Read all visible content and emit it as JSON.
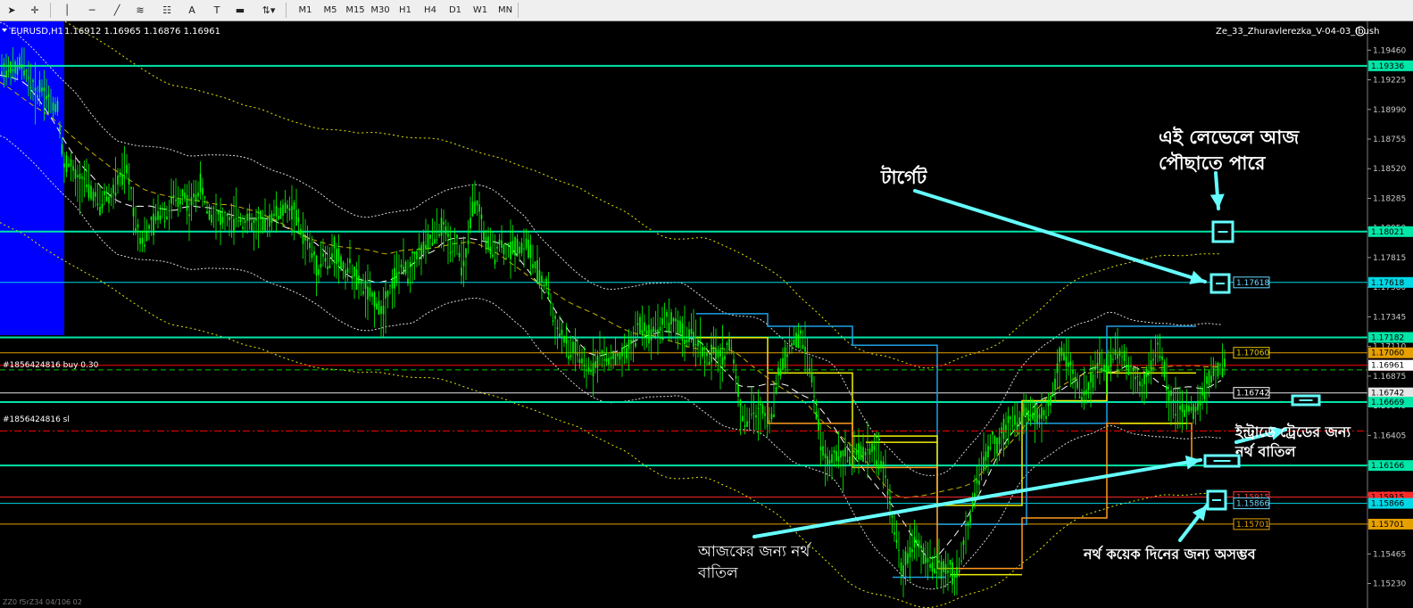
{
  "toolbar": {
    "tools": [
      {
        "name": "cursor-icon",
        "glyph": "➤"
      },
      {
        "name": "crosshair-icon",
        "glyph": "✛"
      },
      {
        "name": "vertical-line-icon",
        "glyph": "│"
      },
      {
        "name": "horizontal-line-icon",
        "glyph": "─"
      },
      {
        "name": "trendline-icon",
        "glyph": "╱"
      },
      {
        "name": "fibonacci-fan-icon",
        "glyph": "≋"
      },
      {
        "name": "fibonacci-retracement-icon",
        "glyph": "☷"
      },
      {
        "name": "text-icon",
        "glyph": "A"
      },
      {
        "name": "text-label-icon",
        "glyph": "T"
      },
      {
        "name": "rectangle-icon",
        "glyph": "▬"
      },
      {
        "name": "shapes-dropdown-icon",
        "glyph": "⇅▾"
      }
    ],
    "timeframes": [
      "M1",
      "M5",
      "M15",
      "M30",
      "H1",
      "H4",
      "D1",
      "W1",
      "MN"
    ]
  },
  "chart_header": {
    "symbol": "EURUSD,H1",
    "ohlc": "1.16912 1.16965 1.16876 1.16961",
    "indicator": "Ze_33_Zhuravlerezka_V-04-03_Ibush"
  },
  "chart_data": {
    "type": "line",
    "symbol": "EURUSD,H1",
    "ylim": [
      1.1505,
      1.1966
    ],
    "y_ticks": [
      1.1946,
      1.19225,
      1.1899,
      1.18755,
      1.1852,
      1.18285,
      1.1805,
      1.17815,
      1.1758,
      1.17345,
      1.1711,
      1.16875,
      1.1664,
      1.16405,
      1.1617,
      1.15935,
      1.157,
      1.15465,
      1.1523
    ],
    "horizontal_levels": [
      {
        "value": 1.19336,
        "label": "1.19336",
        "color": "#00e6a8",
        "width": 2
      },
      {
        "value": 1.18021,
        "label": "1.18021",
        "color": "#00e6a8",
        "width": 2
      },
      {
        "value": 1.17618,
        "label": "1.17618",
        "color": "#00d8e6",
        "width": 1
      },
      {
        "value": 1.17182,
        "label": "1.17182",
        "color": "#00e6a8",
        "width": 2
      },
      {
        "value": 1.1706,
        "label": "1.17060",
        "color": "#e6a000",
        "width": 1
      },
      {
        "value": 1.16961,
        "label": "1.16961",
        "color": "#ff0000",
        "width": 1
      },
      {
        "value": 1.16742,
        "label": "1.16742",
        "color": "#e6e6e6",
        "width": 1
      },
      {
        "value": 1.16669,
        "label": "1.16669",
        "color": "#00e6a8",
        "width": 2
      },
      {
        "value": 1.16166,
        "label": "1.16166",
        "color": "#00e6a8",
        "width": 2
      },
      {
        "value": 1.15915,
        "label": "1.15915",
        "color": "#ff2a2a",
        "width": 1
      },
      {
        "value": 1.15866,
        "label": "1.15866",
        "color": "#00d8e6",
        "width": 1
      },
      {
        "value": 1.15701,
        "label": "1.15701",
        "color": "#e6a000",
        "width": 1
      }
    ],
    "order_lines": [
      {
        "value": 1.16925,
        "label": "#1856424816 buy 0.30",
        "color": "#00c800"
      },
      {
        "value": 1.1644,
        "label": "#1856424816 sl",
        "color": "#ff0000"
      }
    ],
    "current_price": 1.16961,
    "price_path": [
      [
        0,
        1.1925
      ],
      [
        4,
        1.1935
      ],
      [
        8,
        1.1928
      ],
      [
        12,
        1.1932
      ],
      [
        18,
        1.1928
      ],
      [
        22,
        1.1935
      ],
      [
        28,
        1.193
      ],
      [
        34,
        1.1922
      ],
      [
        40,
        1.191
      ],
      [
        46,
        1.1918
      ],
      [
        52,
        1.1912
      ],
      [
        58,
        1.19
      ],
      [
        64,
        1.1905
      ],
      [
        68,
        1.188
      ],
      [
        72,
        1.185
      ],
      [
        76,
        1.186
      ],
      [
        82,
        1.1848
      ],
      [
        88,
        1.184
      ],
      [
        94,
        1.1845
      ],
      [
        100,
        1.1835
      ],
      [
        106,
        1.183
      ],
      [
        112,
        1.1822
      ],
      [
        118,
        1.1832
      ],
      [
        124,
        1.1828
      ],
      [
        130,
        1.184
      ],
      [
        136,
        1.1845
      ],
      [
        142,
        1.185
      ],
      [
        148,
        1.183
      ],
      [
        152,
        1.181
      ],
      [
        158,
        1.1795
      ],
      [
        164,
        1.18
      ],
      [
        170,
        1.1805
      ],
      [
        176,
        1.1815
      ],
      [
        182,
        1.182
      ],
      [
        188,
        1.1815
      ],
      [
        194,
        1.183
      ],
      [
        200,
        1.1825
      ],
      [
        206,
        1.1835
      ],
      [
        212,
        1.182
      ],
      [
        218,
        1.183
      ],
      [
        224,
        1.184
      ],
      [
        230,
        1.1825
      ],
      [
        236,
        1.1815
      ],
      [
        242,
        1.182
      ],
      [
        248,
        1.181
      ],
      [
        254,
        1.1812
      ],
      [
        260,
        1.1808
      ],
      [
        266,
        1.1815
      ],
      [
        272,
        1.181
      ],
      [
        278,
        1.1812
      ],
      [
        284,
        1.1805
      ],
      [
        290,
        1.181
      ],
      [
        296,
        1.1807
      ],
      [
        302,
        1.1812
      ],
      [
        308,
        1.1818
      ],
      [
        314,
        1.1815
      ],
      [
        320,
        1.1822
      ],
      [
        326,
        1.182
      ],
      [
        332,
        1.1815
      ],
      [
        338,
        1.18
      ],
      [
        344,
        1.1795
      ],
      [
        350,
        1.1785
      ],
      [
        356,
        1.177
      ],
      [
        362,
        1.1785
      ],
      [
        368,
        1.1775
      ],
      [
        374,
        1.179
      ],
      [
        380,
        1.178
      ],
      [
        386,
        1.177
      ],
      [
        392,
        1.1775
      ],
      [
        398,
        1.1765
      ],
      [
        404,
        1.176
      ],
      [
        410,
        1.1755
      ],
      [
        416,
        1.175
      ],
      [
        422,
        1.1745
      ],
      [
        428,
        1.1738
      ],
      [
        434,
        1.1752
      ],
      [
        440,
        1.1762
      ],
      [
        446,
        1.177
      ],
      [
        452,
        1.1775
      ],
      [
        458,
        1.177
      ],
      [
        464,
        1.178
      ],
      [
        470,
        1.1785
      ],
      [
        476,
        1.179
      ],
      [
        482,
        1.1795
      ],
      [
        488,
        1.18
      ],
      [
        494,
        1.1805
      ],
      [
        500,
        1.18
      ],
      [
        506,
        1.179
      ],
      [
        512,
        1.1795
      ],
      [
        518,
        1.177
      ],
      [
        524,
        1.179
      ],
      [
        530,
        1.1825
      ],
      [
        536,
        1.182
      ],
      [
        542,
        1.18
      ],
      [
        548,
        1.179
      ],
      [
        554,
        1.1785
      ],
      [
        560,
        1.1795
      ],
      [
        566,
        1.1785
      ],
      [
        572,
        1.179
      ],
      [
        578,
        1.1792
      ],
      [
        584,
        1.1788
      ],
      [
        590,
        1.1795
      ],
      [
        596,
        1.178
      ],
      [
        602,
        1.177
      ],
      [
        608,
        1.176
      ],
      [
        614,
        1.176
      ],
      [
        620,
        1.173
      ],
      [
        626,
        1.1725
      ],
      [
        632,
        1.1715
      ],
      [
        638,
        1.1705
      ],
      [
        644,
        1.171
      ],
      [
        650,
        1.17
      ],
      [
        656,
        1.169
      ],
      [
        662,
        1.1695
      ],
      [
        668,
        1.17
      ],
      [
        674,
        1.1705
      ],
      [
        680,
        1.1698
      ],
      [
        686,
        1.1705
      ],
      [
        692,
        1.17
      ],
      [
        698,
        1.1702
      ],
      [
        704,
        1.171
      ],
      [
        710,
        1.1715
      ],
      [
        716,
        1.173
      ],
      [
        722,
        1.1725
      ],
      [
        728,
        1.172
      ],
      [
        734,
        1.173
      ],
      [
        740,
        1.1725
      ],
      [
        746,
        1.1735
      ],
      [
        752,
        1.173
      ],
      [
        758,
        1.1728
      ],
      [
        764,
        1.1722
      ],
      [
        770,
        1.172
      ],
      [
        776,
        1.1718
      ],
      [
        782,
        1.1715
      ],
      [
        788,
        1.1705
      ],
      [
        794,
        1.17
      ],
      [
        800,
        1.171
      ],
      [
        806,
        1.17
      ],
      [
        812,
        1.1705
      ],
      [
        818,
        1.1715
      ],
      [
        824,
        1.169
      ],
      [
        830,
        1.166
      ],
      [
        836,
        1.165
      ],
      [
        842,
        1.166
      ],
      [
        848,
        1.1655
      ],
      [
        854,
        1.1662
      ],
      [
        860,
        1.165
      ],
      [
        866,
        1.166
      ],
      [
        872,
        1.169
      ],
      [
        878,
        1.17
      ],
      [
        884,
        1.171
      ],
      [
        890,
        1.1715
      ],
      [
        896,
        1.172
      ],
      [
        902,
        1.171
      ],
      [
        908,
        1.1695
      ],
      [
        914,
        1.166
      ],
      [
        920,
        1.1635
      ],
      [
        926,
        1.1615
      ],
      [
        932,
        1.162
      ],
      [
        938,
        1.1628
      ],
      [
        944,
        1.1622
      ],
      [
        950,
        1.1625
      ],
      [
        956,
        1.162
      ],
      [
        962,
        1.1628
      ],
      [
        968,
        1.1625
      ],
      [
        974,
        1.163
      ],
      [
        980,
        1.1628
      ],
      [
        986,
        1.162
      ],
      [
        992,
        1.161
      ],
      [
        998,
        1.158
      ],
      [
        1004,
        1.156
      ],
      [
        1010,
        1.153
      ],
      [
        1016,
        1.1545
      ],
      [
        1022,
        1.1555
      ],
      [
        1028,
        1.156
      ],
      [
        1034,
        1.1545
      ],
      [
        1040,
        1.154
      ],
      [
        1046,
        1.1535
      ],
      [
        1052,
        1.154
      ],
      [
        1058,
        1.153
      ],
      [
        1064,
        1.1535
      ],
      [
        1070,
        1.1528
      ],
      [
        1076,
        1.154
      ],
      [
        1082,
        1.156
      ],
      [
        1088,
        1.158
      ],
      [
        1094,
        1.16
      ],
      [
        1100,
        1.1615
      ],
      [
        1106,
        1.1625
      ],
      [
        1112,
        1.164
      ],
      [
        1118,
        1.163
      ],
      [
        1124,
        1.1645
      ],
      [
        1130,
        1.165
      ],
      [
        1136,
        1.1655
      ],
      [
        1142,
        1.165
      ],
      [
        1148,
        1.166
      ],
      [
        1154,
        1.1655
      ],
      [
        1160,
        1.1658
      ],
      [
        1166,
        1.1652
      ],
      [
        1172,
        1.166
      ],
      [
        1178,
        1.167
      ],
      [
        1184,
        1.169
      ],
      [
        1190,
        1.171
      ],
      [
        1196,
        1.17
      ],
      [
        1202,
        1.169
      ],
      [
        1208,
        1.168
      ],
      [
        1214,
        1.167
      ],
      [
        1220,
        1.168
      ],
      [
        1226,
        1.169
      ],
      [
        1232,
        1.17
      ],
      [
        1238,
        1.169
      ],
      [
        1244,
        1.17
      ],
      [
        1250,
        1.171
      ],
      [
        1256,
        1.1705
      ],
      [
        1262,
        1.17
      ],
      [
        1268,
        1.169
      ],
      [
        1274,
        1.1685
      ],
      [
        1280,
        1.168
      ],
      [
        1286,
        1.169
      ],
      [
        1292,
        1.17
      ],
      [
        1298,
        1.171
      ],
      [
        1304,
        1.1695
      ],
      [
        1310,
        1.167
      ],
      [
        1316,
        1.1665
      ],
      [
        1322,
        1.166
      ],
      [
        1328,
        1.1658
      ],
      [
        1334,
        1.1662
      ],
      [
        1340,
        1.166
      ],
      [
        1346,
        1.167
      ],
      [
        1352,
        1.168
      ],
      [
        1358,
        1.169
      ],
      [
        1364,
        1.1692
      ],
      [
        1370,
        1.1695
      ]
    ],
    "highlight_zone": {
      "x_end": 72,
      "color": "#0000ff"
    }
  },
  "annotations": {
    "today_can_reach_line1": "এই লেভেলে আজ",
    "today_can_reach_line2": "পৌছাতে পারে",
    "target": "টার্গেট",
    "intraday_stop_line1": "ইন্ট্রাডে ট্রেডের জন্য",
    "intraday_stop_line2": "নর্থ বাতিল",
    "today_stop_line1": "আজকের জন্য নর্থ",
    "today_stop_line2": "বাতিল",
    "impossible_days": "নর্থ কয়েক দিনের জন্য অসম্ভব",
    "bottom_left_info": "ZZ0 f5rZ34 04/106 02"
  },
  "colors": {
    "candle": "#00ff00",
    "grid_level": "#00e6a8",
    "arrow": "#66ffff",
    "background": "#000000"
  }
}
